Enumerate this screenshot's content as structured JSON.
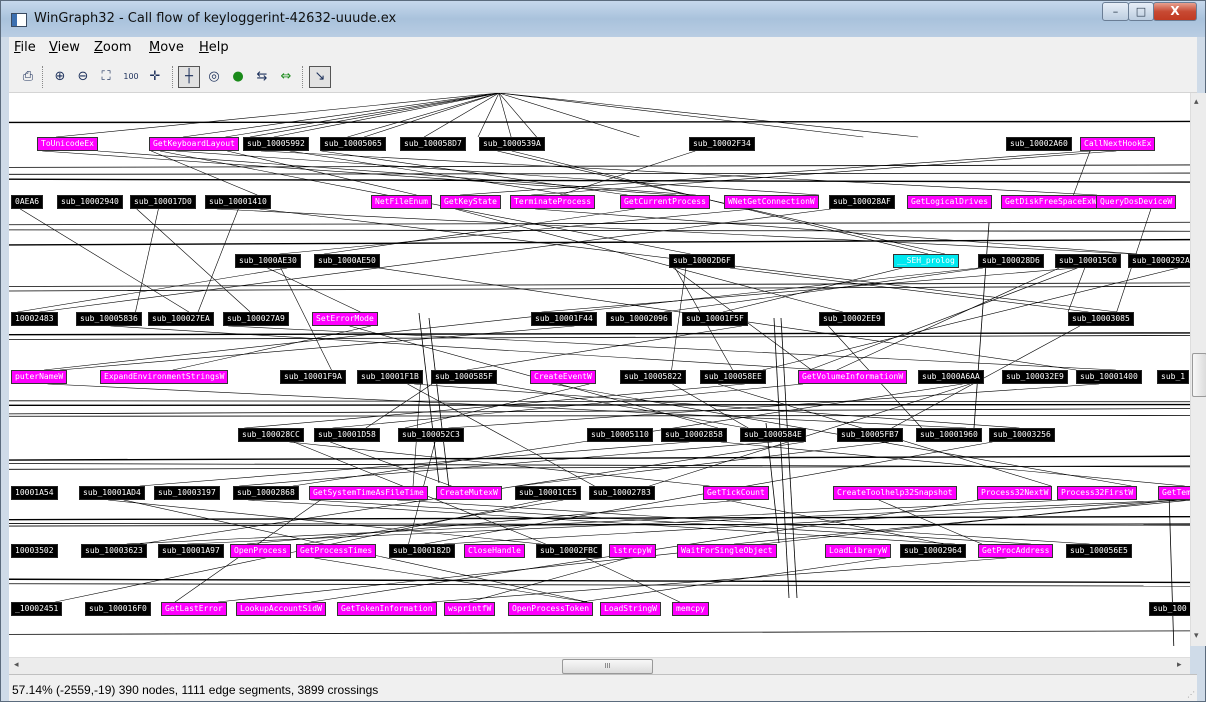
{
  "window": {
    "title": "WinGraph32 - Call flow of keyloggerint-42632-uuude.ex"
  },
  "controls": {
    "minimize": "–",
    "maximize": "□",
    "close": "X"
  },
  "menu": [
    {
      "mnemonic": "F",
      "rest": "ile"
    },
    {
      "mnemonic": "V",
      "rest": "iew"
    },
    {
      "mnemonic": "Z",
      "rest": "oom"
    },
    {
      "mnemonic": "M",
      "rest": "ove"
    },
    {
      "mnemonic": "H",
      "rest": "elp"
    }
  ],
  "toolbar": [
    {
      "icon": "printer-icon",
      "glyph": "⎙"
    },
    {
      "icon": "zoom-in-icon",
      "glyph": "⊕"
    },
    {
      "icon": "zoom-out-icon",
      "glyph": "⊖"
    },
    {
      "icon": "fit-window-icon",
      "glyph": "⛶"
    },
    {
      "icon": "zoom-100-icon",
      "glyph": "100"
    },
    {
      "icon": "center-icon",
      "glyph": "✛"
    },
    {
      "icon": "north-icon",
      "glyph": "┼"
    },
    {
      "icon": "circle-icon",
      "glyph": "◎"
    },
    {
      "icon": "green-circle-icon",
      "glyph": "●"
    },
    {
      "icon": "fold-icon",
      "glyph": "⇆"
    },
    {
      "icon": "green-arrows-icon",
      "glyph": "⇔"
    },
    {
      "icon": "edge-follow-icon",
      "glyph": "↘"
    }
  ],
  "graph": {
    "nodes": [
      {
        "label": "ToUnicodeEx",
        "kind": "api"
      },
      {
        "label": "GetKeyboardLayout",
        "kind": "api"
      },
      {
        "label": "sub_10005992",
        "kind": "sub"
      },
      {
        "label": "sub_10005065",
        "kind": "sub"
      },
      {
        "label": "sub_100058D7",
        "kind": "sub"
      },
      {
        "label": "sub_1000539A",
        "kind": "sub"
      },
      {
        "label": "sub_10002F34",
        "kind": "sub"
      },
      {
        "label": "sub_10002A60",
        "kind": "sub"
      },
      {
        "label": "CallNextHookEx",
        "kind": "api"
      },
      {
        "label": "0AEA6",
        "kind": "sub"
      },
      {
        "label": "sub_10002940",
        "kind": "sub"
      },
      {
        "label": "sub_100017D0",
        "kind": "sub"
      },
      {
        "label": "sub_10001410",
        "kind": "sub"
      },
      {
        "label": "NetFileEnum",
        "kind": "api"
      },
      {
        "label": "GetKeyState",
        "kind": "api"
      },
      {
        "label": "TerminateProcess",
        "kind": "api"
      },
      {
        "label": "GetCurrentProcess",
        "kind": "api"
      },
      {
        "label": "WNetGetConnectionW",
        "kind": "api"
      },
      {
        "label": "sub_100028AF",
        "kind": "sub"
      },
      {
        "label": "GetLogicalDrives",
        "kind": "api"
      },
      {
        "label": "GetDiskFreeSpaceExW",
        "kind": "api"
      },
      {
        "label": "QueryDosDeviceW",
        "kind": "api"
      },
      {
        "label": "sub_1000AE30",
        "kind": "sub"
      },
      {
        "label": "sub_1000AE50",
        "kind": "sub"
      },
      {
        "label": "sub_10002D6F",
        "kind": "sub"
      },
      {
        "label": "__SEH_prolog",
        "kind": "seh"
      },
      {
        "label": "sub_100028D6",
        "kind": "sub"
      },
      {
        "label": "sub_100015C0",
        "kind": "sub"
      },
      {
        "label": "sub_1000292A",
        "kind": "sub"
      },
      {
        "label": "10002483",
        "kind": "sub"
      },
      {
        "label": "sub_10005836",
        "kind": "sub"
      },
      {
        "label": "sub_100027EA",
        "kind": "sub"
      },
      {
        "label": "sub_100027A9",
        "kind": "sub"
      },
      {
        "label": "SetErrorMode",
        "kind": "api"
      },
      {
        "label": "sub_10001F44",
        "kind": "sub"
      },
      {
        "label": "sub_10002096",
        "kind": "sub"
      },
      {
        "label": "sub_10001F5F",
        "kind": "sub"
      },
      {
        "label": "sub_10002EE9",
        "kind": "sub"
      },
      {
        "label": "sub_10003085",
        "kind": "sub"
      },
      {
        "label": "puterNameW",
        "kind": "api"
      },
      {
        "label": "ExpandEnvironmentStringsW",
        "kind": "api"
      },
      {
        "label": "sub_10001F9A",
        "kind": "sub"
      },
      {
        "label": "sub_10001F1B",
        "kind": "sub"
      },
      {
        "label": "sub_1000585F",
        "kind": "sub"
      },
      {
        "label": "CreateEventW",
        "kind": "api"
      },
      {
        "label": "sub_10005822",
        "kind": "sub"
      },
      {
        "label": "sub_100058EE",
        "kind": "sub"
      },
      {
        "label": "GetVolumeInformationW",
        "kind": "api"
      },
      {
        "label": "sub_1000A6AA",
        "kind": "sub"
      },
      {
        "label": "sub_100032E9",
        "kind": "sub"
      },
      {
        "label": "sub_10001400",
        "kind": "sub"
      },
      {
        "label": "sub_1",
        "kind": "sub"
      },
      {
        "label": "sub_100028CC",
        "kind": "sub"
      },
      {
        "label": "sub_10001D58",
        "kind": "sub"
      },
      {
        "label": "sub_100052C3",
        "kind": "sub"
      },
      {
        "label": "sub_10005110",
        "kind": "sub"
      },
      {
        "label": "sub_10002858",
        "kind": "sub"
      },
      {
        "label": "sub_1000584E",
        "kind": "sub"
      },
      {
        "label": "sub_10005FB7",
        "kind": "sub"
      },
      {
        "label": "sub_10001960",
        "kind": "sub"
      },
      {
        "label": "sub_10003256",
        "kind": "sub"
      },
      {
        "label": "10001A54",
        "kind": "sub"
      },
      {
        "label": "sub_10001AD4",
        "kind": "sub"
      },
      {
        "label": "sub_10003197",
        "kind": "sub"
      },
      {
        "label": "sub_10002868",
        "kind": "sub"
      },
      {
        "label": "GetSystemTimeAsFileTime",
        "kind": "api"
      },
      {
        "label": "CreateMutexW",
        "kind": "api"
      },
      {
        "label": "sub_10001CE5",
        "kind": "sub"
      },
      {
        "label": "sub_10002783",
        "kind": "sub"
      },
      {
        "label": "GetTickCount",
        "kind": "api"
      },
      {
        "label": "CreateToolhelp32Snapshot",
        "kind": "api"
      },
      {
        "label": "Process32NextW",
        "kind": "api"
      },
      {
        "label": "Process32FirstW",
        "kind": "api"
      },
      {
        "label": "GetTem",
        "kind": "api"
      },
      {
        "label": "10003502",
        "kind": "sub"
      },
      {
        "label": "sub_10003623",
        "kind": "sub"
      },
      {
        "label": "sub_10001A97",
        "kind": "sub"
      },
      {
        "label": "OpenProcess",
        "kind": "api"
      },
      {
        "label": "GetProcessTimes",
        "kind": "api"
      },
      {
        "label": "sub_1000182D",
        "kind": "sub"
      },
      {
        "label": "CloseHandle",
        "kind": "api"
      },
      {
        "label": "sub_10002FBC",
        "kind": "sub"
      },
      {
        "label": "lstrcpyW",
        "kind": "api"
      },
      {
        "label": "WaitForSingleObject",
        "kind": "api"
      },
      {
        "label": "LoadLibraryW",
        "kind": "api"
      },
      {
        "label": "sub_10002964",
        "kind": "sub"
      },
      {
        "label": "GetProcAddress",
        "kind": "api"
      },
      {
        "label": "sub_100056E5",
        "kind": "sub"
      },
      {
        "label": "_10002451",
        "kind": "sub"
      },
      {
        "label": "sub_100016F0",
        "kind": "sub"
      },
      {
        "label": "GetLastError",
        "kind": "api"
      },
      {
        "label": "LookupAccountSidW",
        "kind": "api"
      },
      {
        "label": "GetTokenInformation",
        "kind": "api"
      },
      {
        "label": "wsprintfW",
        "kind": "api"
      },
      {
        "label": "OpenProcessToken",
        "kind": "api"
      },
      {
        "label": "LoadStringW",
        "kind": "api"
      },
      {
        "label": "memcpy",
        "kind": "api"
      },
      {
        "label": "sub_100",
        "kind": "sub"
      }
    ]
  },
  "scroll": {
    "hthumb_glyph": "III",
    "left_arrow": "◂",
    "right_arrow": "▸",
    "up_arrow": "▴",
    "down_arrow": "▾"
  },
  "status": "57.14% (-2559,-19) 390 nodes, 1111 edge segments, 3899 crossings"
}
